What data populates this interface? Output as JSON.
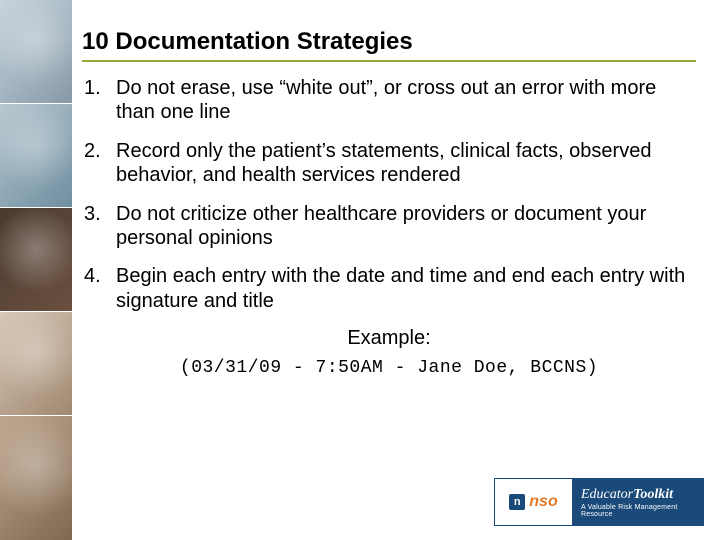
{
  "title": "10 Documentation Strategies",
  "items": [
    {
      "num": "1.",
      "text": "Do not erase, use “white out”, or cross out an error with more than one line"
    },
    {
      "num": "2.",
      "text": "Record only the patient’s statements, clinical facts, observed behavior, and health services rendered"
    },
    {
      "num": "3.",
      "text": "Do not criticize other healthcare providers or document your personal opinions"
    },
    {
      "num": "4.",
      "text": "Begin each entry with the date and time and end each entry with signature and title"
    }
  ],
  "example": {
    "label": "Example:",
    "text": "(03/31/09 - 7:50AM - Jane Doe, BCCNS)"
  },
  "logo": {
    "badge": "n",
    "brand": "nso",
    "line1_a": "Educator",
    "line1_b": "Toolkit",
    "line2": "A Valuable Risk Management Resource"
  }
}
